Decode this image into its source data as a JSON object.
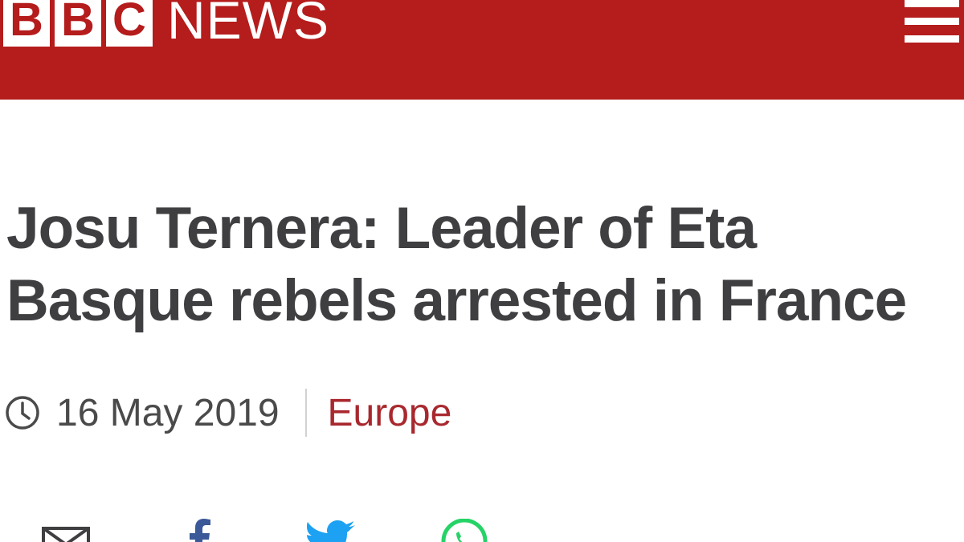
{
  "header": {
    "logo_letters": [
      "B",
      "B",
      "C"
    ],
    "logo_word": "NEWS",
    "brand_color": "#b51c1c"
  },
  "article": {
    "headline_line1": "Josu Ternera: Leader of Eta",
    "headline_line2": "Basque rebels arrested in France",
    "date": "16 May 2019",
    "section": "Europe",
    "section_color": "#a8282e"
  },
  "share": {
    "icons": [
      "email-icon",
      "facebook-icon",
      "twitter-icon",
      "whatsapp-icon"
    ]
  }
}
